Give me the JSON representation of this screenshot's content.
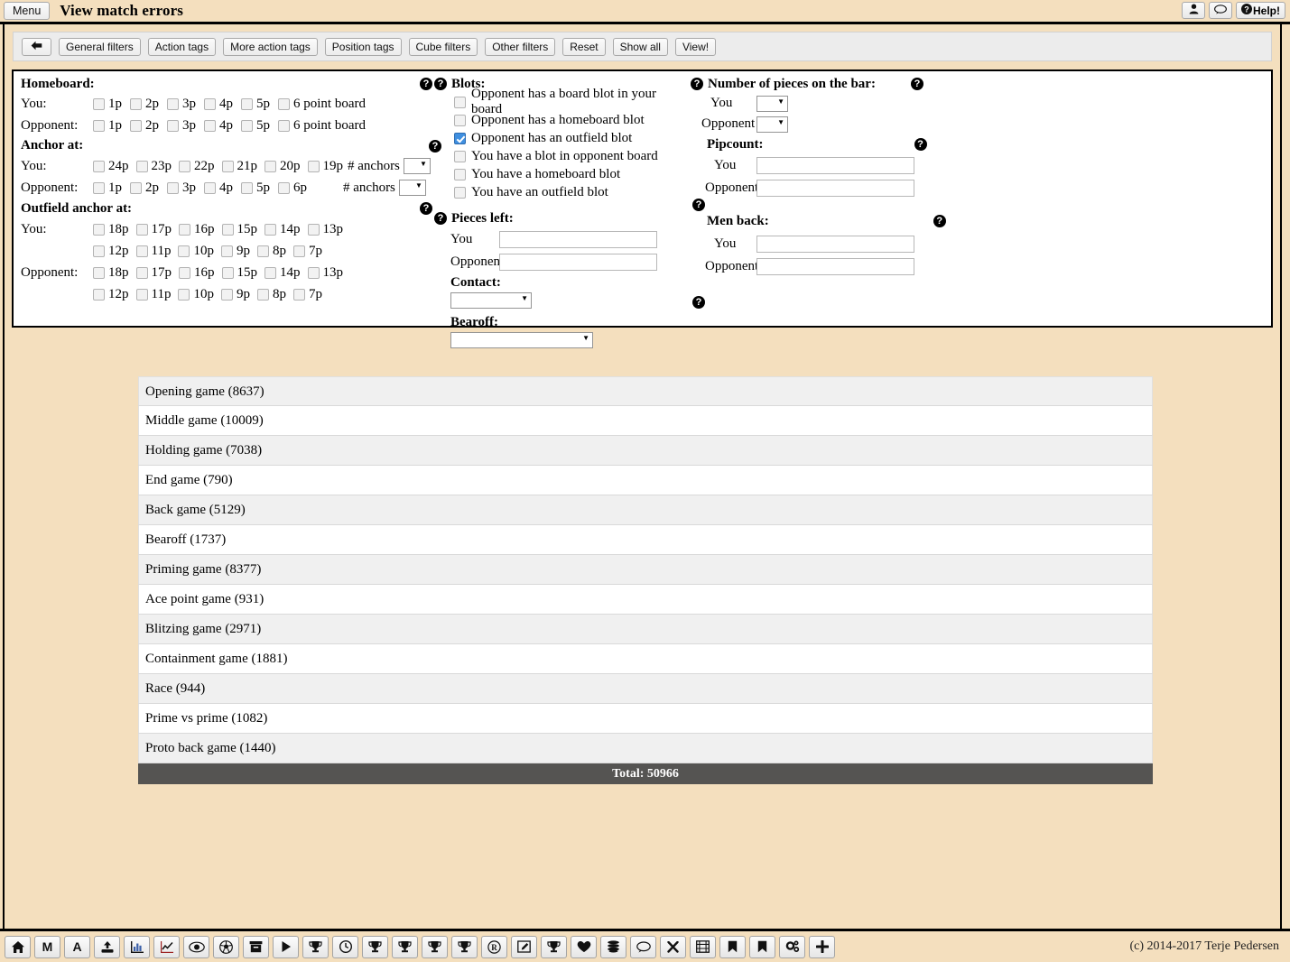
{
  "titlebar": {
    "menu_label": "Menu",
    "title": "View match errors",
    "user_icon": "user-icon",
    "chat_icon": "speech-bubble-icon",
    "help_label": "Help!"
  },
  "filter_toolbar": {
    "back_icon": "arrow-left-icon",
    "buttons": [
      "General filters",
      "Action tags",
      "More action tags",
      "Position tags",
      "Cube filters",
      "Other filters",
      "Reset",
      "Show all",
      "View!"
    ]
  },
  "filters": {
    "homeboard": {
      "title": "Homeboard:",
      "you_label": "You:",
      "opponent_label": "Opponent:",
      "you_points": [
        "1p",
        "2p",
        "3p",
        "4p",
        "5p",
        "6 point board"
      ],
      "opponent_points": [
        "1p",
        "2p",
        "3p",
        "4p",
        "5p",
        "6 point board"
      ]
    },
    "anchor_at": {
      "title": "Anchor at:",
      "you_label": "You:",
      "opponent_label": "Opponent:",
      "you_points": [
        "24p",
        "23p",
        "22p",
        "21p",
        "20p",
        "19p"
      ],
      "opponent_points": [
        "1p",
        "2p",
        "3p",
        "4p",
        "5p",
        "6p"
      ],
      "anchors_label": "# anchors",
      "you_anchors_value": "",
      "opponent_anchors_value": ""
    },
    "outfield_anchor_at": {
      "title": "Outfield anchor at:",
      "you_label": "You:",
      "opponent_label": "Opponent:",
      "you_row1": [
        "18p",
        "17p",
        "16p",
        "15p",
        "14p",
        "13p"
      ],
      "you_row2": [
        "12p",
        "11p",
        "10p",
        "9p",
        "8p",
        "7p"
      ],
      "opponent_row1": [
        "18p",
        "17p",
        "16p",
        "15p",
        "14p",
        "13p"
      ],
      "opponent_row2": [
        "12p",
        "11p",
        "10p",
        "9p",
        "8p",
        "7p"
      ]
    },
    "blots": {
      "title": "Blots:",
      "items": [
        {
          "label": "Opponent has a board blot in your board",
          "checked": false
        },
        {
          "label": "Opponent has a homeboard blot",
          "checked": false
        },
        {
          "label": "Opponent has an outfield blot",
          "checked": true
        },
        {
          "label": "You have a blot in opponent board",
          "checked": false
        },
        {
          "label": "You have a homeboard blot",
          "checked": false
        },
        {
          "label": "You have an outfield blot",
          "checked": false
        }
      ]
    },
    "pieces_left": {
      "title": "Pieces left:",
      "you_label": "You",
      "opponent_label": "Opponent",
      "you_value": "",
      "opponent_value": ""
    },
    "contact": {
      "title": "Contact:",
      "value": ""
    },
    "bearoff": {
      "title": "Bearoff:",
      "value": ""
    },
    "pieces_on_bar": {
      "title": "Number of pieces on the bar:",
      "you_label": "You",
      "opponent_label": "Opponent",
      "you_value": "",
      "opponent_value": ""
    },
    "pipcount": {
      "title": "Pipcount:",
      "you_label": "You",
      "opponent_label": "Opponent",
      "you_value": "",
      "opponent_value": ""
    },
    "men_back": {
      "title": "Men back:",
      "you_label": "You",
      "opponent_label": "Opponent",
      "you_value": "",
      "opponent_value": ""
    },
    "help_icon_label": "?"
  },
  "results": {
    "rows": [
      "Opening game (8637)",
      "Middle game (10009)",
      "Holding game (7038)",
      "End game (790)",
      "Back game (5129)",
      "Bearoff (1737)",
      "Priming game (8377)",
      "Ace point game (931)",
      "Blitzing game (2971)",
      "Containment game (1881)",
      "Race (944)",
      "Prime vs prime (1082)",
      "Proto back game (1440)"
    ],
    "total_label": "Total: 50966"
  },
  "bottom_toolbar": {
    "icons": [
      "home-icon",
      "m-letter-icon",
      "a-letter-icon",
      "upload-icon",
      "bar-chart-icon",
      "line-chart-icon",
      "eye-icon",
      "soccer-ball-icon",
      "archive-box-icon",
      "play-icon",
      "trophy-icon",
      "clock-icon",
      "trophy-icon",
      "trophy-icon",
      "trophy-icon",
      "trophy-icon",
      "registered-icon",
      "edit-icon",
      "trophy-icon",
      "heart-icon",
      "database-icon",
      "speech-bubble-icon",
      "close-x-icon",
      "film-icon",
      "bookmark-icon",
      "bookmark-icon",
      "settings-gears-icon",
      "plus-icon"
    ],
    "copyright": "(c) 2014-2017 Terje Pedersen"
  },
  "colors": {
    "background": "#f4dfbe",
    "panel": "#ffffff",
    "total_bar": "#555452",
    "row_alt": "#f0f0f0",
    "checked_checkbox": "#3f8fe0"
  }
}
